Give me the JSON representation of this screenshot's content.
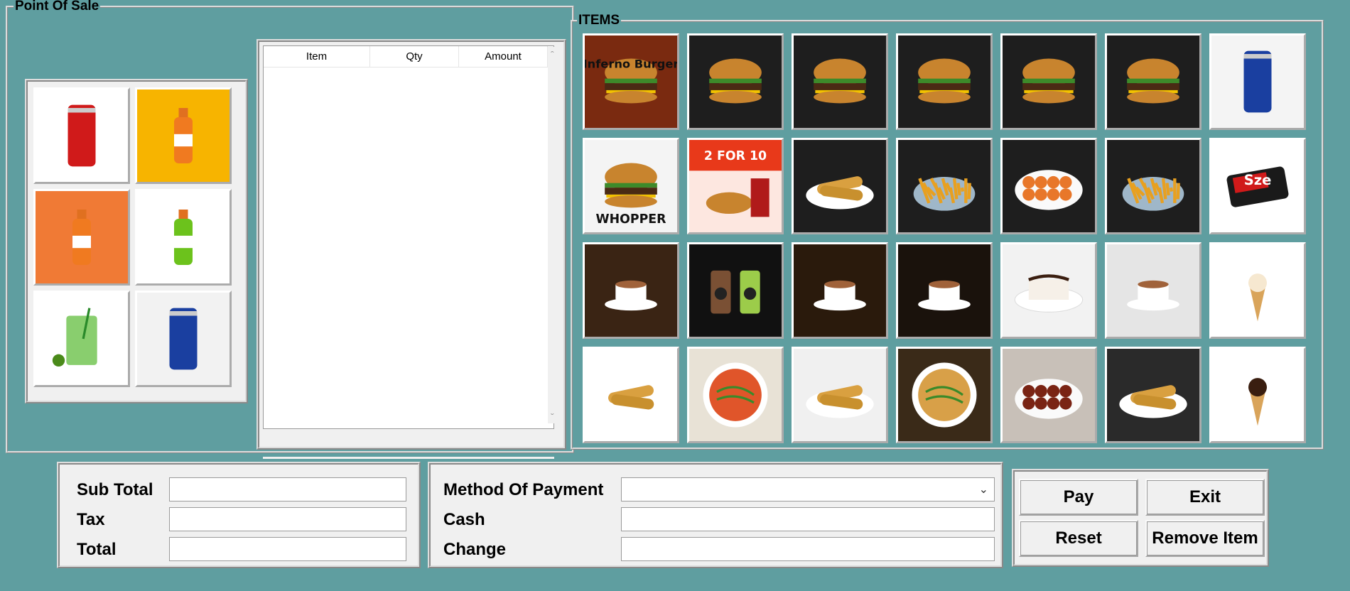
{
  "pos_panel": {
    "title": "Point Of Sale"
  },
  "items_panel": {
    "title": "ITEMS"
  },
  "order_list": {
    "columns": [
      "Item",
      "Qty",
      "Amount"
    ]
  },
  "drinks": [
    {
      "name": "coca-cola-can"
    },
    {
      "name": "mango-juice-bottle"
    },
    {
      "name": "orange-juice-bottle"
    },
    {
      "name": "mountain-dew-bottle"
    },
    {
      "name": "green-mojito-glass"
    },
    {
      "name": "thums-up-can"
    }
  ],
  "menu_items": [
    {
      "name": "inferno-burger",
      "label": "Inferno Burger"
    },
    {
      "name": "cheeseburger"
    },
    {
      "name": "black-bun-burger"
    },
    {
      "name": "egg-burger"
    },
    {
      "name": "burger-with-fries"
    },
    {
      "name": "steak-burger"
    },
    {
      "name": "candy-bar"
    },
    {
      "name": "whopper",
      "label": "WHOPPER"
    },
    {
      "name": "whopper-meal",
      "label": "2 FOR 10"
    },
    {
      "name": "spring-rolls-plate"
    },
    {
      "name": "french-fries"
    },
    {
      "name": "nuggets"
    },
    {
      "name": "fries-with-dip"
    },
    {
      "name": "szechuan-sauce",
      "label": "Sze"
    },
    {
      "name": "cappuccino"
    },
    {
      "name": "frappes"
    },
    {
      "name": "espresso"
    },
    {
      "name": "iced-coffee"
    },
    {
      "name": "cake-slice"
    },
    {
      "name": "latte"
    },
    {
      "name": "ice-cream-cone"
    },
    {
      "name": "samosa"
    },
    {
      "name": "pasta"
    },
    {
      "name": "spring-rolls"
    },
    {
      "name": "noodles"
    },
    {
      "name": "manchurian"
    },
    {
      "name": "tacos"
    },
    {
      "name": "chocolate-cone"
    }
  ],
  "totals": {
    "sub_total_label": "Sub Total",
    "sub_total_value": "",
    "tax_label": "Tax",
    "tax_value": "",
    "total_label": "Total",
    "total_value": ""
  },
  "payment": {
    "method_label": "Method Of Payment",
    "method_value": "",
    "cash_label": "Cash",
    "cash_value": "",
    "change_label": "Change",
    "change_value": ""
  },
  "buttons": {
    "pay": "Pay",
    "exit": "Exit",
    "reset": "Reset",
    "remove": "Remove Item"
  }
}
